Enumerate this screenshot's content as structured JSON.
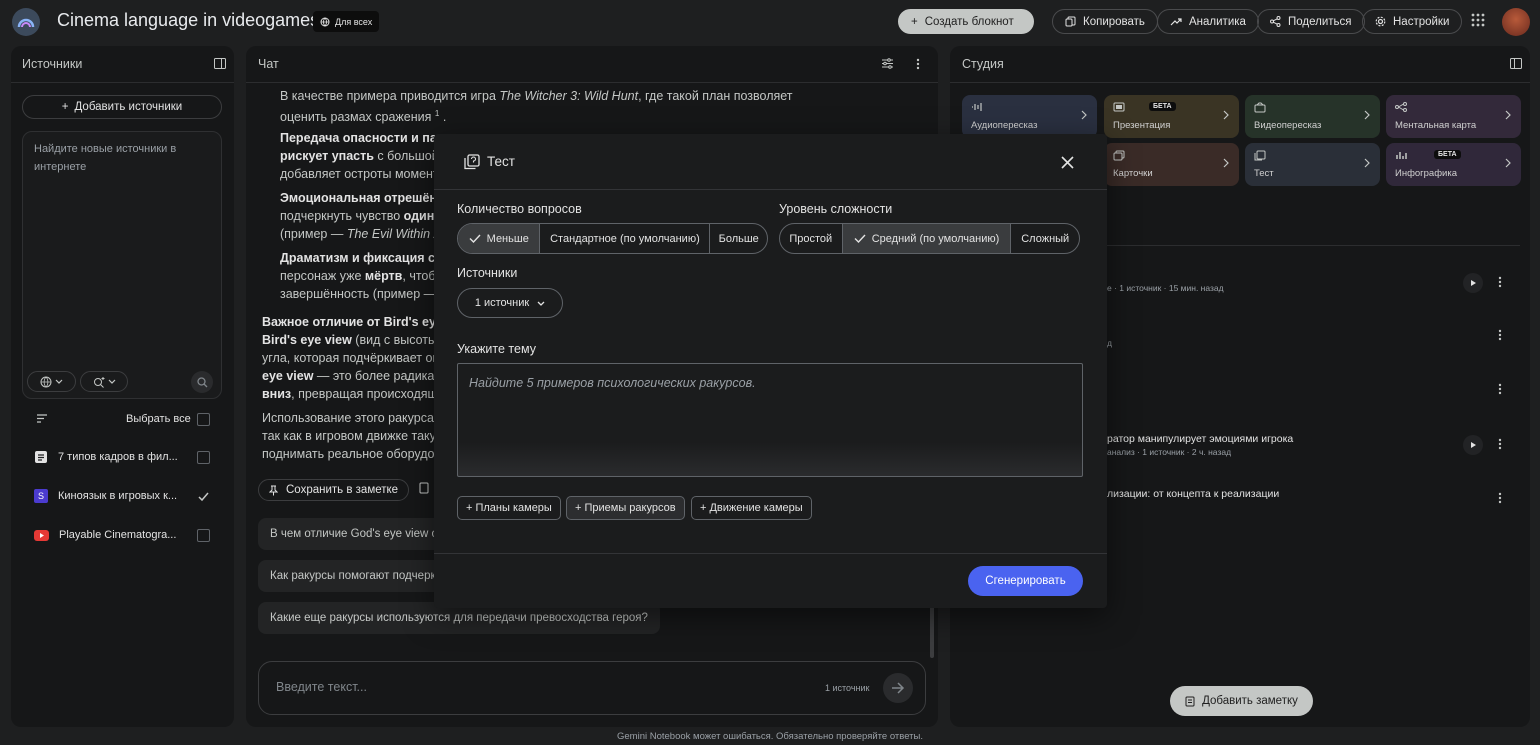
{
  "app": {
    "title": "Cinema language in videogames",
    "share_badge": "Для всех",
    "footer": "Gemini Notebook может ошибаться. Обязательно проверяйте ответы."
  },
  "toolbar": {
    "create": "Создать блокнот",
    "copy": "Копировать",
    "analytics": "Аналитика",
    "share": "Поделиться",
    "settings": "Настройки"
  },
  "sources": {
    "heading": "Источники",
    "add_label": "Добавить источники",
    "search_placeholder": "Найдите новые источники в интернете",
    "select_all": "Выбрать все",
    "items": [
      {
        "label": "7 типов кадров в фил...",
        "icon": "doc-icon",
        "checked": false
      },
      {
        "label": "Киноязык в игровых к...",
        "icon": "s-icon",
        "checked": true
      },
      {
        "label": "Playable Cinematogra...",
        "icon": "youtube-icon",
        "checked": false
      }
    ]
  },
  "chat": {
    "heading": "Чат",
    "p1a": "В качестве примера приводится игра ",
    "p1b": "The Witcher 3: Wild Hunt",
    "p1c": ", где такой план позволяет",
    "p1d": "оценить размах сражения",
    "cite1": "1",
    "b2": "Передача опасности и па",
    "b2b": "рискует упасть",
    "b2c": " с большой",
    "b2d": "добавляет остроты момент",
    "b3": "Эмоциональная отрешён",
    "b3a": "подчеркнуть чувство ",
    "b3b": "один",
    "b3c": "(пример — ",
    "b3d": "The Evil Within 2",
    "b4": "Драматизм и фиксация с",
    "b4a": "персонаж уже ",
    "b4b": "мёртв",
    "b4c": ", чтоб",
    "b4d": "завершённость (пример —",
    "p5": "Важное отличие от Bird's eye",
    "p5b": "Bird's eye view",
    "p5c": " (вид с высоты",
    "p5d": "угла, которая подчёркивает он",
    "p5e": "eye view",
    "p5f": " — это более радикал",
    "p5g": "вниз",
    "p5h": ", превращая происходящ",
    "p6a": "Использование этого ракурса",
    "p6b": "так как в игровом движке таку",
    "p6c": "поднимать реальное оборудо",
    "save_note": "Сохранить в заметке",
    "suggestions": [
      "В чем отличие God's eye view от B",
      "Как ракурсы помогают подчеркн",
      "Какие еще ракурсы используются для передачи превосходства героя?"
    ],
    "input_placeholder": "Введите текст...",
    "source_count": "1 источник"
  },
  "studio": {
    "heading": "Студия",
    "tiles": [
      {
        "label": "Аудиопересказ",
        "beta": "",
        "color": "#2a3040"
      },
      {
        "label": "Презентация",
        "beta": "БЕТА",
        "color": "#3a3424"
      },
      {
        "label": "Видеопересказ",
        "beta": "",
        "color": "#263329"
      },
      {
        "label": "Ментальная карта",
        "beta": "",
        "color": "#33293a"
      },
      {
        "label": "Карточки",
        "beta": "",
        "color": "#3a2b27"
      },
      {
        "label": "Тест",
        "beta": "",
        "color": "#2a2f38"
      },
      {
        "label": "Инфографика",
        "beta": "БЕТА",
        "color": "#30283a"
      }
    ],
    "rows": [
      {
        "title": "",
        "sub": "е · 1 источник · 15 мин. назад"
      },
      {
        "title": "",
        "sub": "д"
      },
      {
        "title": "ратор манипулирует эмоциями игрока",
        "sub": "анализ · 1 источник · 2 ч. назад"
      },
      {
        "title": "лизации: от концепта к реализации",
        "sub": ""
      }
    ],
    "add_note": "Добавить заметку"
  },
  "quiz_modal": {
    "title": "Тест",
    "count_label": "Количество вопросов",
    "count_options": [
      "Меньше",
      "Стандартное (по умолчанию)",
      "Больше"
    ],
    "count_selected": "Меньше",
    "difficulty_label": "Уровень сложности",
    "difficulty_options": [
      "Простой",
      "Средний (по умолчанию)",
      "Сложный"
    ],
    "difficulty_selected": "Средний (по умолчанию)",
    "sources_label": "Источники",
    "sources_value": "1 источник",
    "topic_label": "Укажите тему",
    "topic_placeholder": "Найдите 5 примеров психологических ракурсов.",
    "chips": [
      "+ Планы камеры",
      "+ Приемы ракурсов",
      "+ Движение камеры"
    ],
    "generate": "Сгенерировать"
  }
}
